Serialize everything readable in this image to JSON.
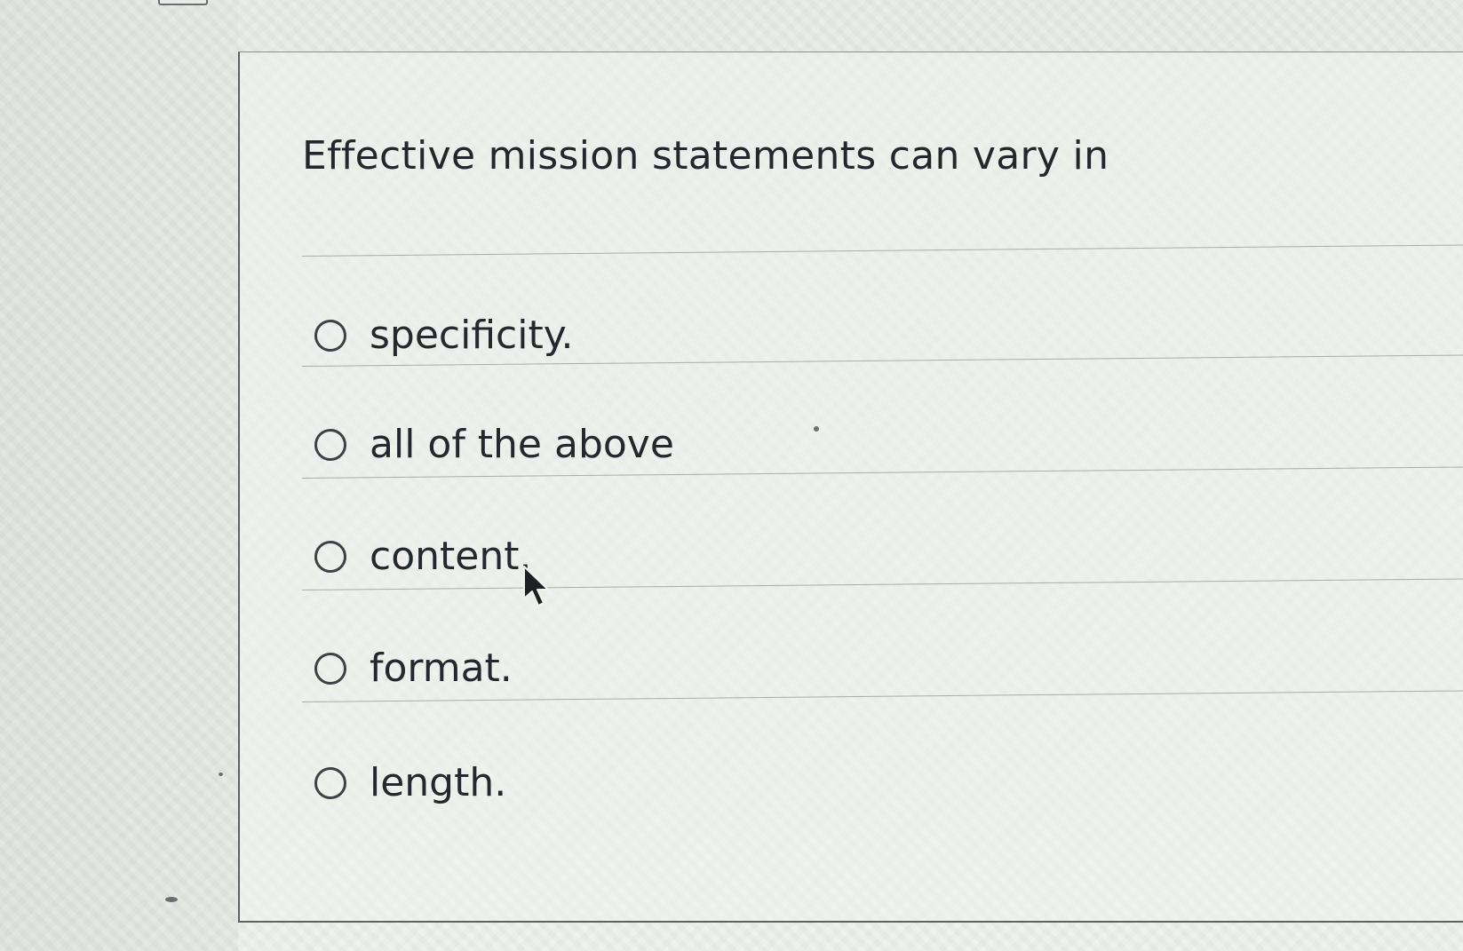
{
  "question": {
    "text": "Effective mission statements can vary in"
  },
  "options": [
    {
      "label": "specificity.",
      "selected": false
    },
    {
      "label": "all of the above",
      "selected": false
    },
    {
      "label": "content.",
      "selected": false
    },
    {
      "label": "format.",
      "selected": false
    },
    {
      "label": "length.",
      "selected": false
    }
  ],
  "colors": {
    "text": "#25292d",
    "radio_border": "#3e4246",
    "divider": "#a9adab",
    "panel_border": "#5e6266"
  }
}
